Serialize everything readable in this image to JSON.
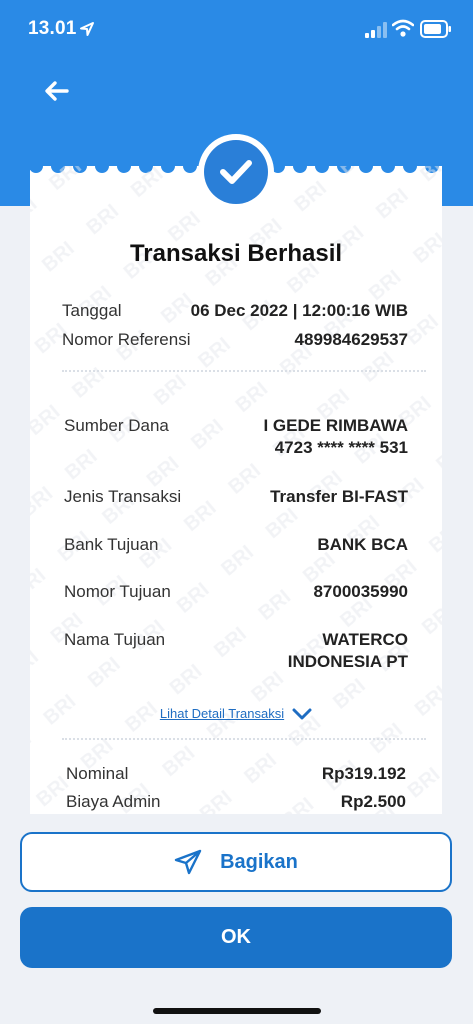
{
  "status_bar": {
    "time": "13.01",
    "icons": [
      "location-arrow-icon",
      "cellular-signal-icon",
      "wifi-icon",
      "battery-icon"
    ]
  },
  "header": {
    "back_icon": "arrow-left-icon"
  },
  "receipt": {
    "status_icon": "check-circle-icon",
    "title": "Transaksi Berhasil",
    "watermark_text": "BRI",
    "meta": [
      {
        "label": "Tanggal",
        "value": "06 Dec 2022 | 12:00:16 WIB"
      },
      {
        "label": "Nomor Referensi",
        "value": "489984629537"
      }
    ],
    "details": {
      "sumber_dana": {
        "label": "Sumber Dana",
        "value_line1": "I GEDE RIMBAWA",
        "value_line2": "4723 **** **** 531"
      },
      "jenis_transaksi": {
        "label": "Jenis Transaksi",
        "value": "Transfer BI-FAST"
      },
      "bank_tujuan": {
        "label": "Bank Tujuan",
        "value": "BANK BCA"
      },
      "nomor_tujuan": {
        "label": "Nomor Tujuan",
        "value": "8700035990"
      },
      "nama_tujuan": {
        "label": "Nama Tujuan",
        "value_line1": "WATERCO",
        "value_line2": "INDONESIA PT"
      }
    },
    "detail_link": "Lihat Detail Transaksi",
    "amounts": [
      {
        "label": "Nominal",
        "value": "Rp319.192"
      },
      {
        "label": "Biaya Admin",
        "value": "Rp2.500"
      }
    ]
  },
  "actions": {
    "share_label": "Bagikan",
    "share_icon": "paper-plane-icon",
    "ok_label": "OK"
  },
  "colors": {
    "header_blue": "#2a8ae6",
    "primary": "#1a73c9",
    "background": "#eef1f6"
  }
}
